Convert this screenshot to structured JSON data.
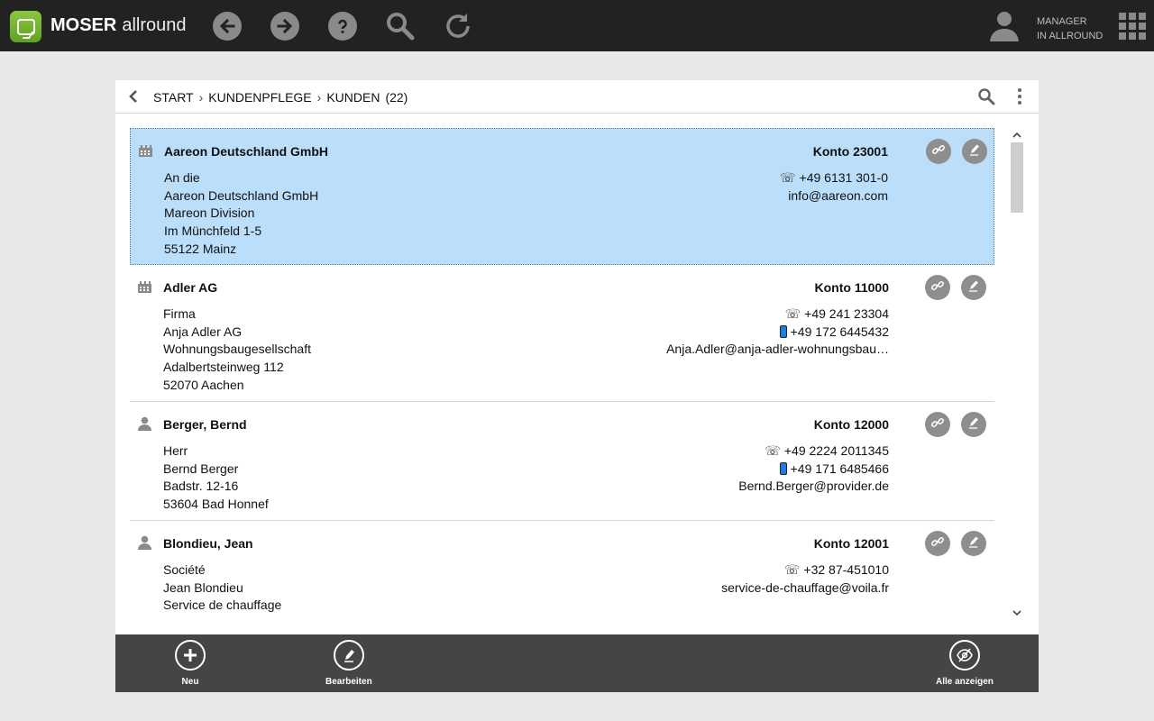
{
  "app": {
    "brand_bold": "MOSER",
    "brand_light": "allround",
    "user_line1": "MANAGER",
    "user_line2": "IN ALLROUND"
  },
  "breadcrumb": {
    "items": [
      "START",
      "KUNDENPFLEGE",
      "KUNDEN"
    ],
    "count": "(22)"
  },
  "customers": [
    {
      "type": "company",
      "name": "Aareon Deutschland GmbH",
      "konto": "Konto 23001",
      "address": [
        "An die",
        "Aareon Deutschland GmbH",
        "Mareon Division",
        "Im Münchfeld 1-5",
        "55122 Mainz"
      ],
      "phone": "+49 6131 301-0",
      "mobile": "",
      "email": "info@aareon.com",
      "selected": true
    },
    {
      "type": "company",
      "name": "Adler AG",
      "konto": "Konto 11000",
      "address": [
        "Firma",
        "Anja Adler AG",
        "Wohnungsbaugesellschaft",
        "Adalbertsteinweg 112",
        "52070 Aachen"
      ],
      "phone": "+49 241 23304",
      "mobile": "+49 172 6445432",
      "email": "Anja.Adler@anja-adler-wohnungsbau…",
      "selected": false
    },
    {
      "type": "person",
      "name": "Berger, Bernd",
      "konto": "Konto 12000",
      "address": [
        "Herr",
        "Bernd Berger",
        "Badstr. 12-16",
        "53604 Bad Honnef"
      ],
      "phone": "+49 2224 2011345",
      "mobile": "+49 171 6485466",
      "email": "Bernd.Berger@provider.de",
      "selected": false
    },
    {
      "type": "person",
      "name": "Blondieu, Jean",
      "konto": "Konto 12001",
      "address": [
        "Société",
        "Jean Blondieu",
        "Service de chauffage"
      ],
      "phone": "+32 87-451010",
      "mobile": "",
      "email": "service-de-chauffage@voila.fr",
      "selected": false
    }
  ],
  "footer": {
    "new_label": "Neu",
    "edit_label": "Bearbeiten",
    "show_all_label": "Alle anzeigen"
  },
  "colors": {
    "topbar": "#222222",
    "selected_row": "#bbdefa",
    "footer": "#454545",
    "logo_green": "#7ab833"
  }
}
